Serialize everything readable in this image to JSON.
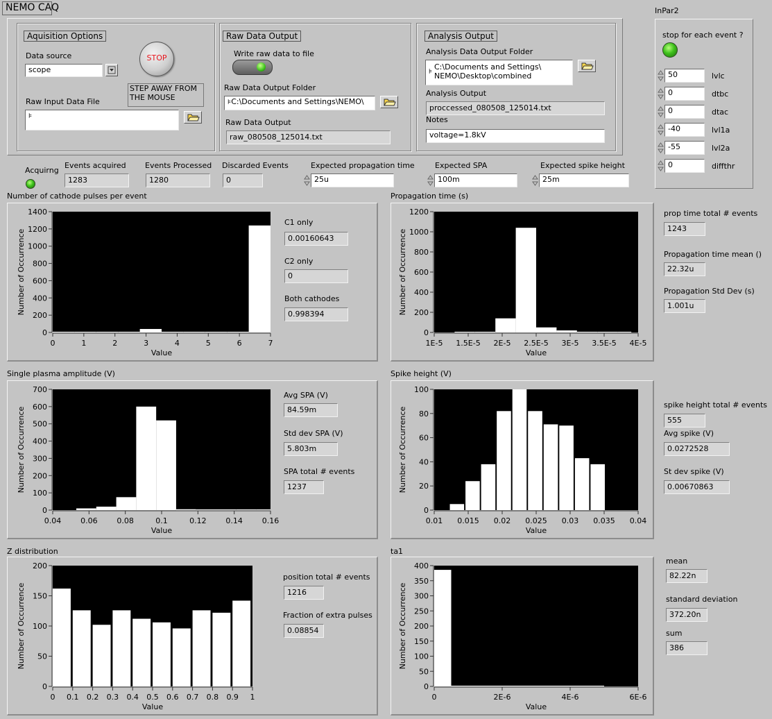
{
  "window_title": "NEMO CAQ",
  "inpar_title": "InPar2",
  "acq": {
    "group_label": "Aquisition Options",
    "data_source_label": "Data source",
    "data_source_value": "scope",
    "stop_label": "STOP",
    "warning": "STEP AWAY FROM THE MOUSE",
    "raw_input_label": "Raw Input Data File",
    "raw_input_value": ""
  },
  "raw": {
    "group_label": "Raw Data Output",
    "write_label": "Write raw data to file",
    "folder_label": "Raw Data Output Folder",
    "folder_value": "C:\\Documents and Settings\\NEMO\\",
    "output_label": "Raw Data Output",
    "output_value": "raw_080508_125014.txt"
  },
  "analysis": {
    "group_label": "Analysis Output",
    "folder_label": "Analysis Data Output Folder",
    "folder_line1": "C:\\Documents and Settings\\",
    "folder_line2": "NEMO\\Desktop\\combined",
    "output_label": "Analysis Output",
    "output_value": "proccessed_080508_125014.txt",
    "notes_label": "Notes",
    "notes_value": "voltage=1.8kV"
  },
  "inpar": {
    "stop_each_label": "stop for each event ?",
    "params": [
      {
        "value": "50",
        "name": "lvlc"
      },
      {
        "value": "0",
        "name": "dtbc"
      },
      {
        "value": "0",
        "name": "dtac"
      },
      {
        "value": "-40",
        "name": "lvl1a"
      },
      {
        "value": "-55",
        "name": "lvl2a"
      },
      {
        "value": "0",
        "name": "diffthr"
      }
    ]
  },
  "status": {
    "acquiring_label": "Acquirng",
    "events_acquired_label": "Events acquired",
    "events_acquired": "1283",
    "events_processed_label": "Events Processed",
    "events_processed": "1280",
    "discarded_label": "Discarded Events",
    "discarded": "0",
    "exp_prop_label": "Expected propagation time",
    "exp_prop": "25u",
    "exp_spa_label": "Expected SPA",
    "exp_spa": "100m",
    "exp_spike_label": "Expected spike height",
    "exp_spike": "25m"
  },
  "side": {
    "c1_label": "C1 only",
    "c1": "0.00160643",
    "c2_label": "C2 only",
    "c2": "0",
    "both_label": "Both cathodes",
    "both": "0.998394",
    "prop_total_label": "prop time total # events",
    "prop_total": "1243",
    "prop_mean_label": "Propagation time mean ()",
    "prop_mean": "22.32u",
    "prop_std_label": "Propagation Std Dev (s)",
    "prop_std": "1.001u",
    "avg_spa_label": "Avg SPA (V)",
    "avg_spa": "84.59m",
    "std_spa_label": "Std dev SPA (V)",
    "std_spa": "5.803m",
    "spa_total_label": "SPA total # events",
    "spa_total": "1237",
    "spike_total_label": "spike height total # events",
    "spike_total": "555",
    "avg_spike_label": "Avg spike (V)",
    "avg_spike": "0.0272528",
    "std_spike_label": "St dev spike (V)",
    "std_spike": "0.00670863",
    "pos_total_label": "position total # events",
    "pos_total": "1216",
    "frac_label": "Fraction of extra pulses",
    "frac": "0.08854",
    "mean_label": "mean",
    "mean": "82.22n",
    "sd_label": "standard deviation",
    "sd": "372.20n",
    "sum_label": "sum",
    "sum": "386"
  },
  "chart_data": [
    {
      "type": "bar",
      "title": "Number of cathode pulses per event",
      "xlabel": "Value",
      "ylabel": "Number of Occurrence",
      "xlim": [
        0,
        7
      ],
      "ylim": [
        0,
        1400
      ],
      "xticks": [
        "0",
        "1",
        "2",
        "3",
        "4",
        "5",
        "6",
        "7"
      ],
      "yticks": [
        "0",
        "200",
        "400",
        "600",
        "800",
        "1000",
        "1200",
        "1400"
      ],
      "bins": [
        {
          "x0": 0,
          "x1": 0.7,
          "y": 3
        },
        {
          "x0": 0.7,
          "x1": 1.4,
          "y": 3
        },
        {
          "x0": 1.4,
          "x1": 2.1,
          "y": 3
        },
        {
          "x0": 2.1,
          "x1": 2.8,
          "y": 3
        },
        {
          "x0": 2.8,
          "x1": 3.5,
          "y": 40
        },
        {
          "x0": 3.5,
          "x1": 4.2,
          "y": 3
        },
        {
          "x0": 4.2,
          "x1": 4.9,
          "y": 3
        },
        {
          "x0": 4.9,
          "x1": 5.6,
          "y": 3
        },
        {
          "x0": 5.6,
          "x1": 6.3,
          "y": 3
        },
        {
          "x0": 6.3,
          "x1": 7.0,
          "y": 1240
        }
      ]
    },
    {
      "type": "bar",
      "title": "Propagation time (s)",
      "xlabel": "Value",
      "ylabel": "Number of Occurrence",
      "xlim": [
        1e-05,
        4e-05
      ],
      "ylim": [
        0,
        1200
      ],
      "xticks": [
        "1E-5",
        "1.5E-5",
        "2E-5",
        "2.5E-5",
        "3E-5",
        "3.5E-5",
        "4E-5"
      ],
      "yticks": [
        "0",
        "200",
        "400",
        "600",
        "800",
        "1000",
        "1200"
      ],
      "bins": [
        {
          "x0": 1.3e-05,
          "x1": 1.6e-05,
          "y": 3
        },
        {
          "x0": 1.6e-05,
          "x1": 1.9e-05,
          "y": 3
        },
        {
          "x0": 1.9e-05,
          "x1": 2.2e-05,
          "y": 140
        },
        {
          "x0": 2.2e-05,
          "x1": 2.5e-05,
          "y": 1040
        },
        {
          "x0": 2.5e-05,
          "x1": 2.8e-05,
          "y": 50
        },
        {
          "x0": 2.8e-05,
          "x1": 3.1e-05,
          "y": 20
        },
        {
          "x0": 3.1e-05,
          "x1": 3.4e-05,
          "y": 3
        },
        {
          "x0": 3.4e-05,
          "x1": 3.7e-05,
          "y": 3
        },
        {
          "x0": 3.7e-05,
          "x1": 3.9e-05,
          "y": 3
        }
      ]
    },
    {
      "type": "bar",
      "title": "Single plasma amplitude (V)",
      "xlabel": "Value",
      "ylabel": "Number of Occurrence",
      "xlim": [
        0.04,
        0.16
      ],
      "ylim": [
        0,
        700
      ],
      "xticks": [
        "0.04",
        "0.06",
        "0.08",
        "0.1",
        "0.12",
        "0.14",
        "0.16"
      ],
      "yticks": [
        "0",
        "100",
        "200",
        "300",
        "400",
        "500",
        "600",
        "700"
      ],
      "bins": [
        {
          "x0": 0.053,
          "x1": 0.064,
          "y": 10
        },
        {
          "x0": 0.064,
          "x1": 0.075,
          "y": 20
        },
        {
          "x0": 0.075,
          "x1": 0.086,
          "y": 75
        },
        {
          "x0": 0.086,
          "x1": 0.097,
          "y": 600
        },
        {
          "x0": 0.097,
          "x1": 0.108,
          "y": 520
        },
        {
          "x0": 0.108,
          "x1": 0.119,
          "y": 5
        },
        {
          "x0": 0.119,
          "x1": 0.13,
          "y": 3
        },
        {
          "x0": 0.13,
          "x1": 0.141,
          "y": 3
        },
        {
          "x0": 0.141,
          "x1": 0.152,
          "y": 3
        },
        {
          "x0": 0.152,
          "x1": 0.16,
          "y": 3
        }
      ]
    },
    {
      "type": "bar",
      "title": "Spike height (V)",
      "xlabel": "Value",
      "ylabel": "Number of Occurrence",
      "xlim": [
        0.01,
        0.04
      ],
      "ylim": [
        0,
        100
      ],
      "xticks": [
        "0.01",
        "0.015",
        "0.02",
        "0.025",
        "0.03",
        "0.035",
        "0.04"
      ],
      "yticks": [
        "0",
        "20",
        "40",
        "60",
        "80",
        "100"
      ],
      "bins": [
        {
          "x0": 0.0123,
          "x1": 0.0144,
          "y": 5
        },
        {
          "x0": 0.0146,
          "x1": 0.0167,
          "y": 24
        },
        {
          "x0": 0.0169,
          "x1": 0.019,
          "y": 38
        },
        {
          "x0": 0.0192,
          "x1": 0.0213,
          "y": 82
        },
        {
          "x0": 0.0215,
          "x1": 0.0236,
          "y": 100
        },
        {
          "x0": 0.0238,
          "x1": 0.0259,
          "y": 82
        },
        {
          "x0": 0.0261,
          "x1": 0.0282,
          "y": 71
        },
        {
          "x0": 0.0284,
          "x1": 0.0305,
          "y": 70
        },
        {
          "x0": 0.0307,
          "x1": 0.0328,
          "y": 43
        },
        {
          "x0": 0.033,
          "x1": 0.0351,
          "y": 38
        }
      ]
    },
    {
      "type": "bar",
      "title": "Z distribution",
      "xlabel": "Value",
      "ylabel": "Number of Occurrence",
      "xlim": [
        0,
        1
      ],
      "ylim": [
        0,
        200
      ],
      "xticks": [
        "0",
        "0.1",
        "0.2",
        "0.3",
        "0.4",
        "0.5",
        "0.6",
        "0.7",
        "0.8",
        "0.9",
        "1"
      ],
      "yticks": [
        "0",
        "50",
        "100",
        "150",
        "200"
      ],
      "bins": [
        {
          "x0": 0.0,
          "x1": 0.09,
          "y": 162
        },
        {
          "x0": 0.1,
          "x1": 0.19,
          "y": 126
        },
        {
          "x0": 0.2,
          "x1": 0.29,
          "y": 102
        },
        {
          "x0": 0.3,
          "x1": 0.39,
          "y": 126
        },
        {
          "x0": 0.4,
          "x1": 0.49,
          "y": 112
        },
        {
          "x0": 0.5,
          "x1": 0.59,
          "y": 106
        },
        {
          "x0": 0.6,
          "x1": 0.69,
          "y": 96
        },
        {
          "x0": 0.7,
          "x1": 0.79,
          "y": 126
        },
        {
          "x0": 0.8,
          "x1": 0.89,
          "y": 122
        },
        {
          "x0": 0.9,
          "x1": 0.99,
          "y": 142
        }
      ]
    },
    {
      "type": "bar",
      "title": "ta1",
      "xlabel": "Value",
      "ylabel": "Number of Occurrence",
      "xlim": [
        0,
        6e-06
      ],
      "ylim": [
        0,
        400
      ],
      "xticks": [
        "0",
        "2E-6",
        "4E-6",
        "6E-6"
      ],
      "yticks": [
        "0",
        "50",
        "100",
        "150",
        "200",
        "250",
        "300",
        "350",
        "400"
      ],
      "bins": [
        {
          "x0": 0,
          "x1": 5e-07,
          "y": 386
        },
        {
          "x0": 5e-07,
          "x1": 1e-06,
          "y": 1
        },
        {
          "x0": 1e-06,
          "x1": 1.5e-06,
          "y": 1
        },
        {
          "x0": 1.5e-06,
          "x1": 2e-06,
          "y": 1
        },
        {
          "x0": 2e-06,
          "x1": 2.5e-06,
          "y": 1
        },
        {
          "x0": 2.5e-06,
          "x1": 3e-06,
          "y": 1
        },
        {
          "x0": 3e-06,
          "x1": 3.5e-06,
          "y": 1
        },
        {
          "x0": 3.5e-06,
          "x1": 4e-06,
          "y": 1
        },
        {
          "x0": 4e-06,
          "x1": 4.5e-06,
          "y": 1
        },
        {
          "x0": 4.5e-06,
          "x1": 5e-06,
          "y": 1
        }
      ]
    }
  ]
}
